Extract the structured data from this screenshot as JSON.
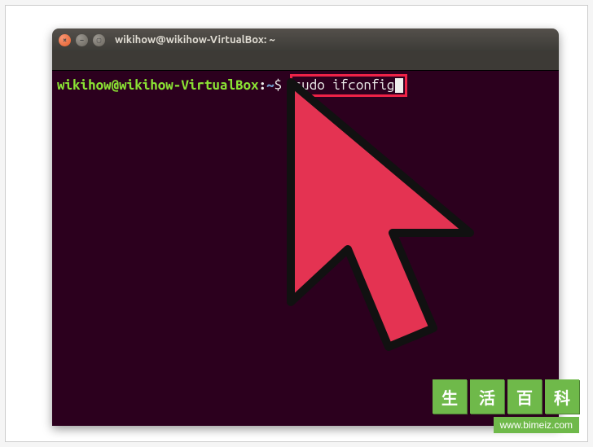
{
  "window": {
    "title": "wikihow@wikihow-VirtualBox: ~"
  },
  "terminal": {
    "prompt_user_host": "wikihow@wikihow-VirtualBox",
    "prompt_colon": ":",
    "prompt_path": "~",
    "prompt_symbol": "$",
    "command": "sudo ifconfig"
  },
  "watermark": {
    "char1": "生",
    "char2": "活",
    "char3": "百",
    "char4": "科",
    "url": "www.bimeiz.com"
  },
  "colors": {
    "terminal_bg": "#2c001e",
    "prompt_green": "#8ae234",
    "prompt_blue": "#729fcf",
    "highlight_red": "#ee2247",
    "cursor_fill": "#e43352",
    "titlebar_close": "#e55e2a"
  }
}
